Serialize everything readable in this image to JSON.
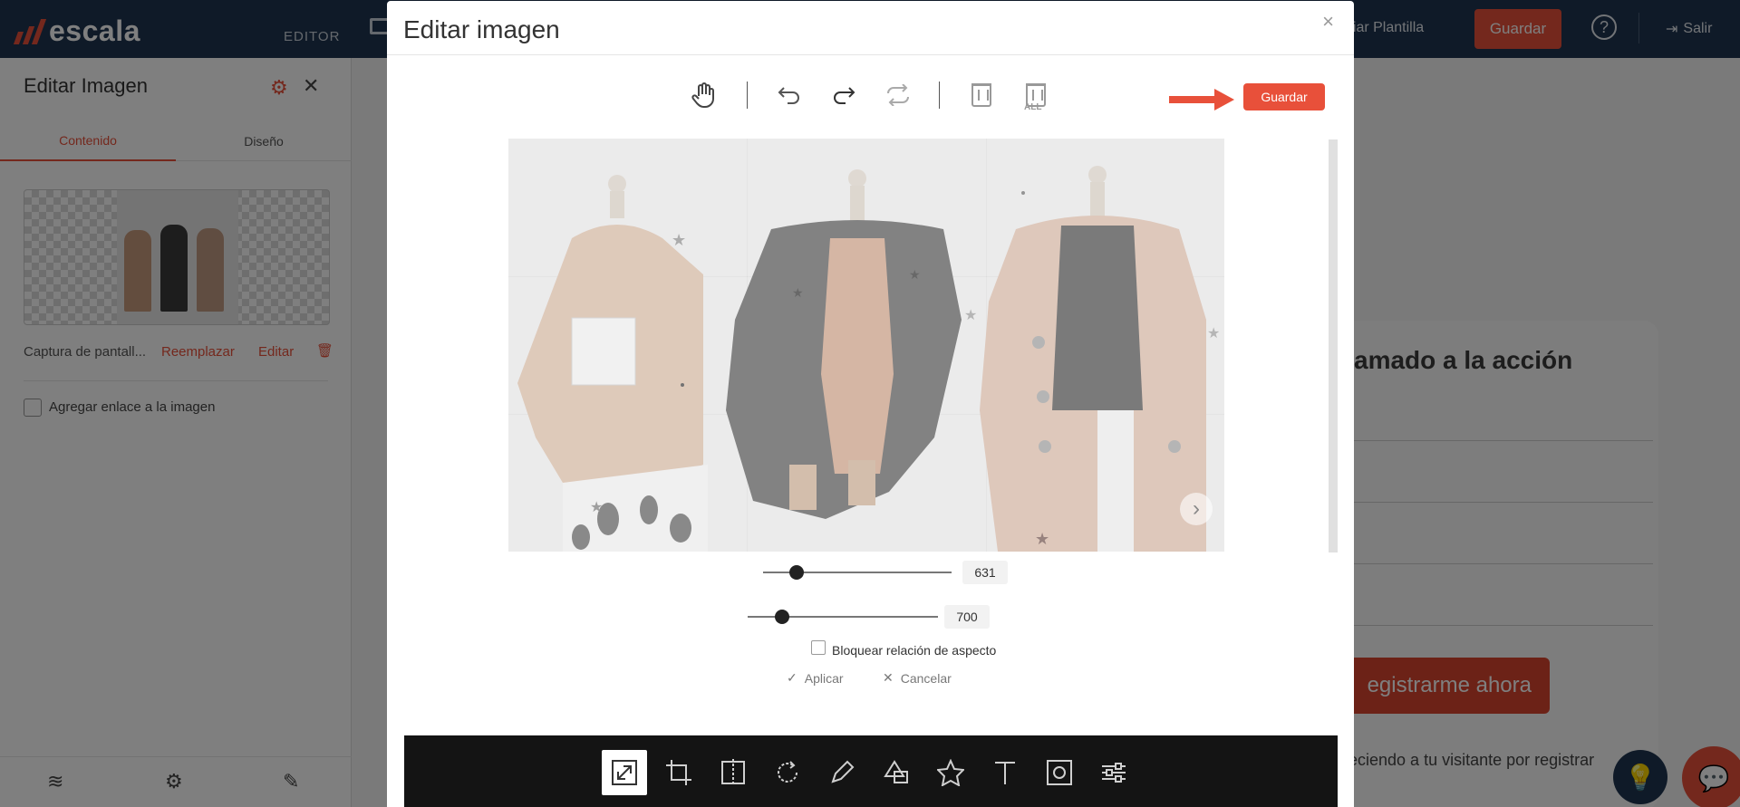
{
  "app": {
    "logo": "escala",
    "mode_label": "EDITOR",
    "template_link": "biar Plantilla",
    "save_label": "Guardar",
    "logout_label": "Salir"
  },
  "sidebar": {
    "title": "Editar Imagen",
    "tabs": [
      "Contenido",
      "Diseño"
    ],
    "active_tab": "Contenido",
    "file_name": "Captura de pantall...",
    "replace_label": "Reemplazar",
    "edit_label": "Editar",
    "link_checkbox_label": "Agregar enlace a la imagen",
    "link_checkbox_checked": false
  },
  "page_preview": {
    "cta_title": "amado a la acción",
    "cta_button": "egistrarme ahora",
    "cta_note": "eciendo a tu visitante por registrar"
  },
  "modal": {
    "title": "Editar imagen",
    "close_symbol": "×",
    "save_label": "Guardar",
    "top_tools": [
      "hand-icon",
      "undo-icon",
      "redo-icon",
      "reset-icon",
      "delete-icon",
      "delete-all-icon"
    ],
    "delete_all_label": "ALL",
    "resize": {
      "width_value": "631",
      "height_value": "700",
      "width_fraction": 0.18,
      "height_fraction": 0.18,
      "lock_label": "Bloquear relación de aspecto",
      "lock_checked": false,
      "apply_label": "Aplicar",
      "cancel_label": "Cancelar"
    },
    "bottom_tools": [
      "resize-icon",
      "crop-icon",
      "flip-icon",
      "rotate-icon",
      "draw-icon",
      "shape-icon",
      "star-icon",
      "text-icon",
      "mask-icon",
      "filter-icon"
    ],
    "active_bottom_tool": "resize-icon"
  },
  "colors": {
    "brand": "#e8503a",
    "topbar": "#1f3550"
  }
}
